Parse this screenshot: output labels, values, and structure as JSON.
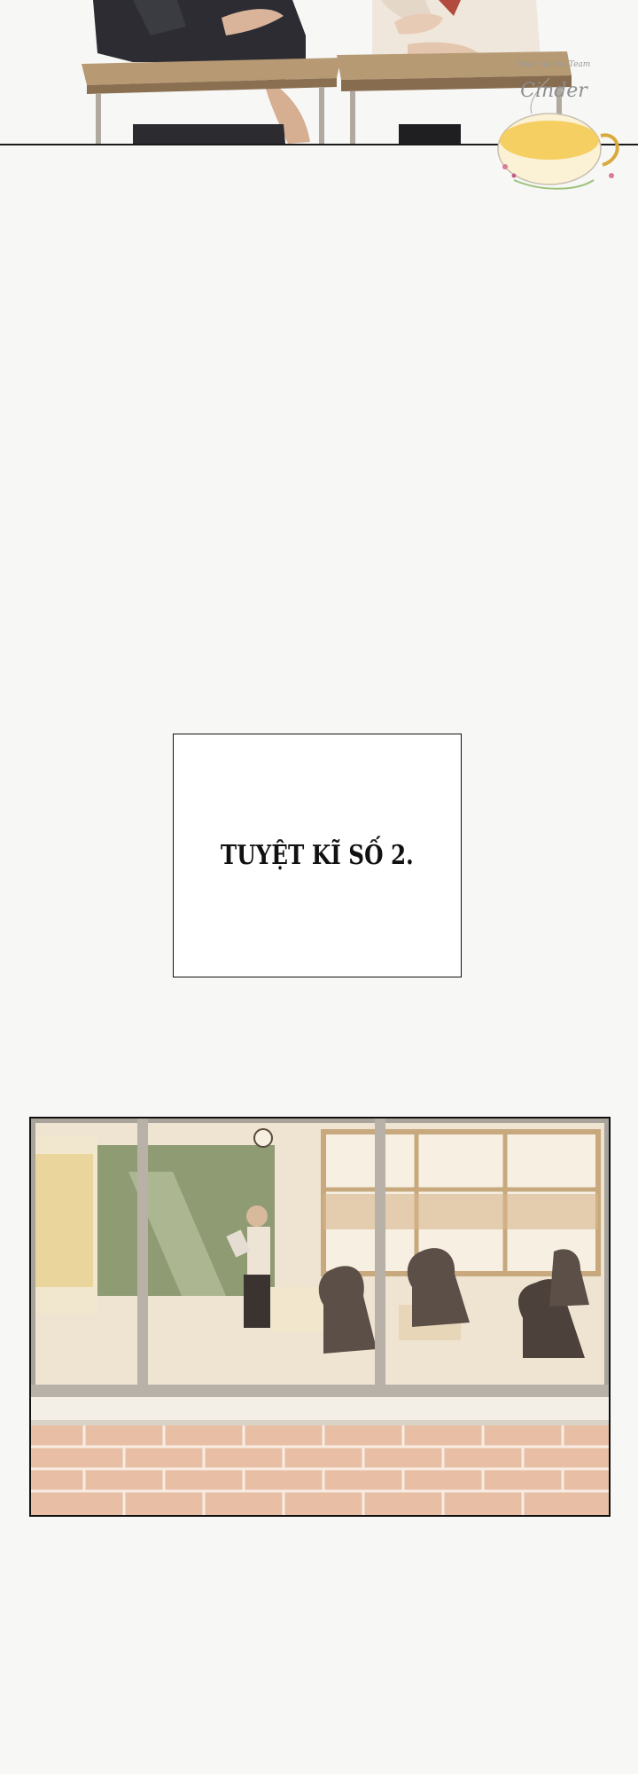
{
  "page": {
    "background_color": "#f7f7f6"
  },
  "top_panel": {
    "description_icon": "students-at-desks-illustration"
  },
  "watermark": {
    "text": "Cinder",
    "tagline": "Beat me the Team",
    "icon": "tea-cup-icon"
  },
  "caption": {
    "text": "TUYỆT KĨ SỐ 2."
  },
  "classroom_panel": {
    "icon": "classroom-window-illustration"
  }
}
